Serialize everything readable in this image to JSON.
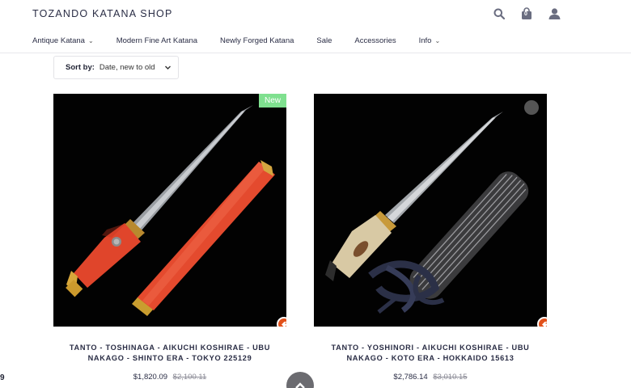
{
  "header": {
    "brand": "TOZANDO KATANA SHOP",
    "cart_count": "0"
  },
  "nav": {
    "items": [
      {
        "label": "Antique Katana",
        "dropdown": true
      },
      {
        "label": "Modern Fine Art Katana",
        "dropdown": false
      },
      {
        "label": "Newly Forged Katana",
        "dropdown": false
      },
      {
        "label": "Sale",
        "dropdown": false
      },
      {
        "label": "Accessories",
        "dropdown": false
      },
      {
        "label": "Info",
        "dropdown": true
      }
    ]
  },
  "sort": {
    "label": "Sort by:",
    "value": "Date, new to old"
  },
  "products": [
    {
      "badge": "New",
      "title": "TANTO - TOSHINAGA - AIKUCHI KOSHIRAE - UBU NAKAGO - SHINTO ERA - TOKYO 225129",
      "price": "$1,820.09",
      "compare_price": "$2,100.11"
    },
    {
      "badge": "",
      "title": "TANTO - YOSHINORI - AIKUCHI KOSHIRAE - UBU NAKAGO - KOTO ERA - HOKKAIDO 15613",
      "price": "$2,786.14",
      "compare_price": "$3,010.15"
    }
  ],
  "colors": {
    "accent_new": "#7fe08f",
    "tag_orange": "#e2511b",
    "text_dark": "#2a2d45"
  },
  "edge_text": "9"
}
